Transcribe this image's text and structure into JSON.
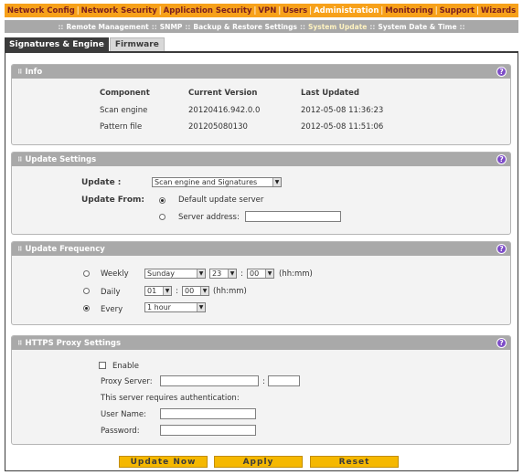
{
  "nav": {
    "items": [
      {
        "label": "Network Config",
        "active": false
      },
      {
        "label": "Network Security",
        "active": false
      },
      {
        "label": "Application Security",
        "active": false
      },
      {
        "label": "VPN",
        "active": false
      },
      {
        "label": "Users",
        "active": false
      },
      {
        "label": "Administration",
        "active": true
      },
      {
        "label": "Monitoring",
        "active": false
      },
      {
        "label": "Support",
        "active": false
      },
      {
        "label": "Wizards",
        "active": false
      }
    ]
  },
  "subnav": {
    "items": [
      {
        "label": "Remote Management",
        "active": false
      },
      {
        "label": "SNMP",
        "active": false
      },
      {
        "label": "Backup & Restore Settings",
        "active": false
      },
      {
        "label": "System Update",
        "active": true
      },
      {
        "label": "System Date & Time",
        "active": false
      }
    ]
  },
  "tabs": {
    "signatures": "Signatures & Engine",
    "firmware": "Firmware"
  },
  "info": {
    "title": "Info",
    "headers": {
      "component": "Component",
      "version": "Current Version",
      "updated": "Last Updated"
    },
    "rows": [
      {
        "component": "Scan engine",
        "version": "20120416.942.0.0",
        "updated": "2012-05-08 11:36:23"
      },
      {
        "component": "Pattern file",
        "version": "201205080130",
        "updated": "2012-05-08 11:51:06"
      }
    ]
  },
  "update_settings": {
    "title": "Update Settings",
    "update_label": "Update :",
    "update_value": "Scan engine and Signatures",
    "from_label": "Update From:",
    "default_server": "Default update server",
    "server_address": "Server address:",
    "server_address_value": ""
  },
  "frequency": {
    "title": "Update Frequency",
    "weekly": "Weekly",
    "weekly_day": "Sunday",
    "weekly_hour": "23",
    "weekly_min": "00",
    "daily": "Daily",
    "daily_hour": "01",
    "daily_min": "00",
    "every": "Every",
    "every_value": "1 hour",
    "hhmm": "(hh:mm)",
    "colon": ":"
  },
  "proxy": {
    "title": "HTTPS Proxy Settings",
    "enable": "Enable",
    "proxy_server": "Proxy Server:",
    "auth_note": "This server requires authentication:",
    "username": "User Name:",
    "password": "Password:",
    "colon": ":"
  },
  "buttons": {
    "update_now": "Update Now",
    "apply": "Apply",
    "reset": "Reset"
  },
  "colors": {
    "nav_orange": "#f7a11a",
    "panel_header": "#a9a9a9",
    "button_yellow": "#f5b800",
    "help_purple": "#7d4cc7"
  }
}
